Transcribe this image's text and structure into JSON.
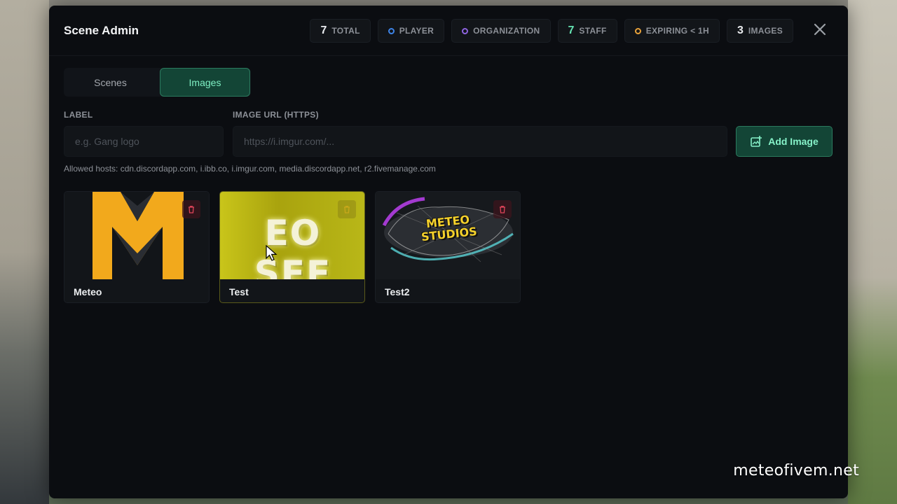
{
  "window": {
    "title": "Scene Admin"
  },
  "stats": [
    {
      "value": "7",
      "label": "TOTAL",
      "dot": null
    },
    {
      "value": "",
      "label": "PLAYER",
      "dot": "#3d84e8"
    },
    {
      "value": "",
      "label": "ORGANIZATION",
      "dot": "#8e64e0"
    },
    {
      "value": "7",
      "label": "STAFF",
      "dot": null,
      "value_color": "#64e3b2"
    },
    {
      "value": "",
      "label": "EXPIRING < 1H",
      "dot": "#e8a23a"
    },
    {
      "value": "3",
      "label": "IMAGES",
      "dot": null
    }
  ],
  "tabs": [
    {
      "label": "Scenes",
      "active": false
    },
    {
      "label": "Images",
      "active": true
    }
  ],
  "form": {
    "label_field": {
      "label": "LABEL",
      "placeholder": "e.g. Gang logo"
    },
    "url_field": {
      "label": "IMAGE URL (HTTPS)",
      "placeholder": "https://i.imgur.com/..."
    },
    "add_button": "Add Image",
    "allowed_hosts": "Allowed hosts: cdn.discordapp.com, i.ibb.co, i.imgur.com, media.discordapp.net, r2.fivemanage.com"
  },
  "images": [
    {
      "name": "Meteo",
      "preview": "meteo-m-logo",
      "logo_text": "M"
    },
    {
      "name": "Test",
      "preview": "yellow-banner",
      "logo_text": "EO SEF"
    },
    {
      "name": "Test2",
      "preview": "graffiti-logo",
      "logo_text": "METEO STUDIOS"
    }
  ],
  "watermark": "meteofivem.net",
  "colors": {
    "accent": "#134536",
    "accent_text": "#7ff0c4",
    "panel": "#0b0d11",
    "danger": "#e0455a"
  }
}
